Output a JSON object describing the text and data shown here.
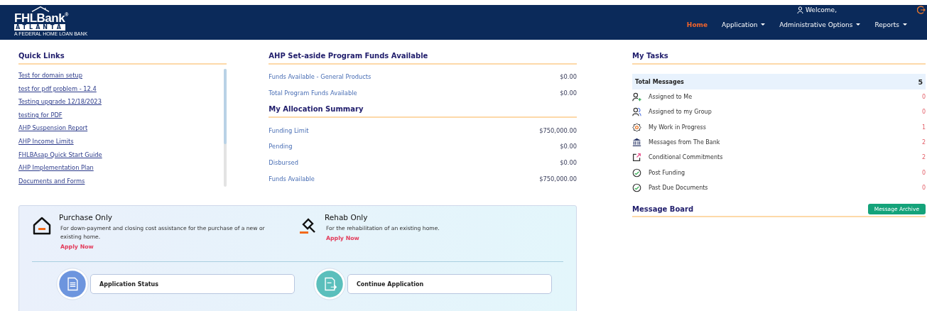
{
  "header": {
    "logo": {
      "name": "FHLBank",
      "mark": "®",
      "city": "ATLANTA",
      "tagline": "A FEDERAL HOME LOAN BANK"
    },
    "welcome": "Welcome,",
    "nav": [
      {
        "label": "Home",
        "selected": true,
        "dropdown": false
      },
      {
        "label": "Application",
        "selected": false,
        "dropdown": true
      },
      {
        "label": "Administrative Options",
        "selected": false,
        "dropdown": true
      },
      {
        "label": "Reports",
        "selected": false,
        "dropdown": true
      }
    ]
  },
  "quick_links": {
    "title": "Quick Links",
    "items": [
      "Test for domain setup",
      "test for pdf problem - 12.4",
      "Testing upgrade 12/18/2023",
      "testing for PDF",
      "AHP Suspension Report",
      "AHP Income Limits",
      "FHLBAsap Quick Start Guide",
      "AHP Implementation Plan",
      "Documents and Forms"
    ]
  },
  "funds": {
    "title": "AHP Set-aside Program Funds Available",
    "rows": [
      {
        "label": "Funds Available - General Products",
        "value": "$0.00"
      },
      {
        "label": "Total Program Funds Available",
        "value": "$0.00"
      }
    ]
  },
  "allocation": {
    "title": "My Allocation Summary",
    "rows": [
      {
        "label": "Funding Limit",
        "value": "$750,000.00"
      },
      {
        "label": "Pending",
        "value": "$0.00"
      },
      {
        "label": "Disbursed",
        "value": "$0.00"
      },
      {
        "label": "Funds Available",
        "value": "$750,000.00"
      }
    ]
  },
  "tasks": {
    "title": "My Tasks",
    "total_label": "Total Messages",
    "total": "5",
    "items": [
      {
        "kind": "user-add",
        "label": "Assigned to Me",
        "count": "0"
      },
      {
        "kind": "group",
        "label": "Assigned to my Group",
        "count": "0"
      },
      {
        "kind": "gear",
        "label": "My Work in Progress",
        "count": "1"
      },
      {
        "kind": "bank",
        "label": "Messages from The Bank",
        "count": "2"
      },
      {
        "kind": "external",
        "label": "Conditional Commitments",
        "count": "2"
      },
      {
        "kind": "check",
        "label": "Post Funding",
        "count": "0"
      },
      {
        "kind": "check",
        "label": "Past Due Documents",
        "count": "0"
      }
    ]
  },
  "message_board": {
    "title": "Message Board",
    "button": "Message Archive"
  },
  "programs": [
    {
      "kind": "house",
      "title": "Purchase Only",
      "description": "For down-payment and closing cost assistance for the purchase of a new or existing home.",
      "link": "Apply Now"
    },
    {
      "kind": "hammer",
      "title": "Rehab Only",
      "description": "For the rehabilitation of an existing home.",
      "link": "Apply Now"
    }
  ],
  "actions": [
    {
      "kind": "status",
      "label": "Application Status"
    },
    {
      "kind": "continue",
      "label": "Continue Application"
    }
  ]
}
